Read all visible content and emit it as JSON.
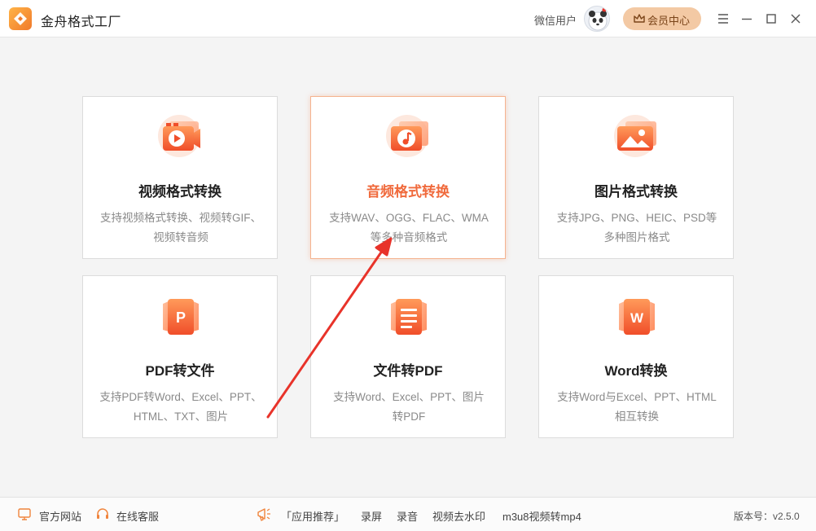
{
  "app": {
    "title": "金舟格式工厂",
    "version_label": "版本号：",
    "version": "v2.5.0"
  },
  "header": {
    "user_name": "微信用户",
    "vip_label": "会员中心"
  },
  "colors": {
    "accent": "#f06a3c",
    "icon_gradient_top": "#ff9a5a",
    "icon_gradient_bottom": "#f04e2a",
    "vip_bg": "#f3c9a4",
    "arrow": "#e8332a"
  },
  "cards": [
    {
      "title": "视频格式转换",
      "desc1": "支持视频格式转换、视频转GIF、",
      "desc2": "视频转音频",
      "icon": "video-convert-icon",
      "active": false
    },
    {
      "title": "音频格式转换",
      "desc1": "支持WAV、OGG、FLAC、WMA",
      "desc2": "等多种音频格式",
      "icon": "audio-convert-icon",
      "active": true
    },
    {
      "title": "图片格式转换",
      "desc1": "支持JPG、PNG、HEIC、PSD等",
      "desc2": "多种图片格式",
      "icon": "image-convert-icon",
      "active": false
    },
    {
      "title": "PDF转文件",
      "desc1": "支持PDF转Word、Excel、PPT、",
      "desc2": "HTML、TXT、图片",
      "icon": "pdf-icon",
      "active": false
    },
    {
      "title": "文件转PDF",
      "desc1": "支持Word、Excel、PPT、图片",
      "desc2": "转PDF",
      "icon": "document-icon",
      "active": false
    },
    {
      "title": "Word转换",
      "desc1": "支持Word与Excel、PPT、HTML",
      "desc2": "相互转换",
      "icon": "word-icon",
      "active": false
    }
  ],
  "footer": {
    "website": "官方网站",
    "support": "在线客服",
    "recommend": "「应用推荐」",
    "links": [
      "录屏",
      "录音",
      "视频去水印",
      "m3u8视频转mp4"
    ]
  }
}
